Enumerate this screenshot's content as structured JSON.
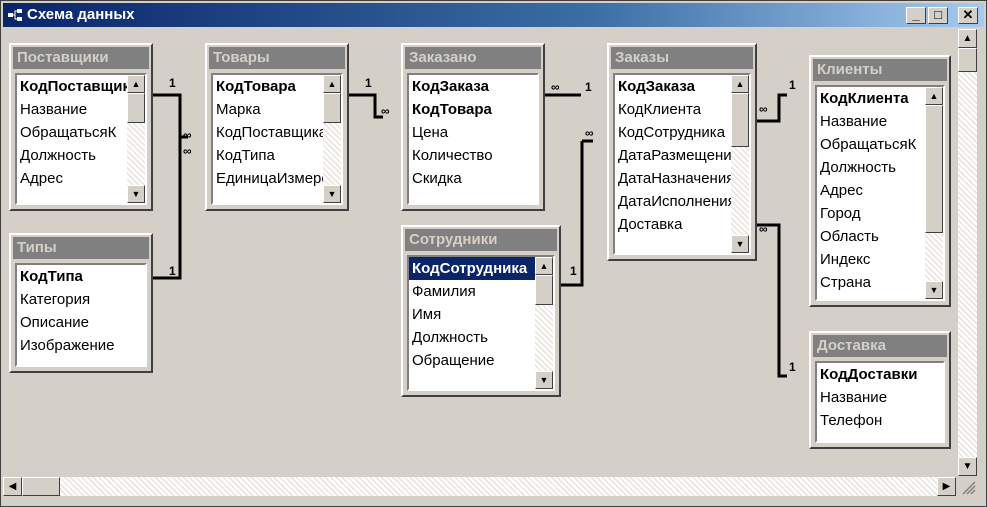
{
  "window": {
    "title": "Схема данных",
    "buttons": {
      "minimize": "_",
      "maximize": "□",
      "close": "✕"
    }
  },
  "tables": {
    "suppliers": {
      "title": "Поставщики",
      "fields": [
        "КодПоставщика",
        "Название",
        "ОбращатьсяК",
        "Должность",
        "Адрес"
      ]
    },
    "products": {
      "title": "Товары",
      "fields": [
        "КодТовара",
        "Марка",
        "КодПоставщика",
        "КодТипа",
        "ЕдиницаИзмерения"
      ]
    },
    "ordered": {
      "title": "Заказано",
      "fields": [
        "КодЗаказа",
        "КодТовара",
        "Цена",
        "Количество",
        "Скидка"
      ]
    },
    "orders": {
      "title": "Заказы",
      "fields": [
        "КодЗаказа",
        "КодКлиента",
        "КодСотрудника",
        "ДатаРазмещения",
        "ДатаНазначения",
        "ДатаИсполнения",
        "Доставка"
      ]
    },
    "clients": {
      "title": "Клиенты",
      "fields": [
        "КодКлиента",
        "Название",
        "ОбращатьсяК",
        "Должность",
        "Адрес",
        "Город",
        "Область",
        "Индекс",
        "Страна"
      ]
    },
    "types": {
      "title": "Типы",
      "fields": [
        "КодТипа",
        "Категория",
        "Описание",
        "Изображение"
      ]
    },
    "employees": {
      "title": "Сотрудники",
      "fields": [
        "КодСотрудника",
        "Фамилия",
        "Имя",
        "Должность",
        "Обращение"
      ]
    },
    "delivery": {
      "title": "Доставка",
      "fields": [
        "КодДоставки",
        "Название",
        "Телефон"
      ]
    }
  },
  "relations": {
    "one": "1",
    "many": "∞"
  }
}
